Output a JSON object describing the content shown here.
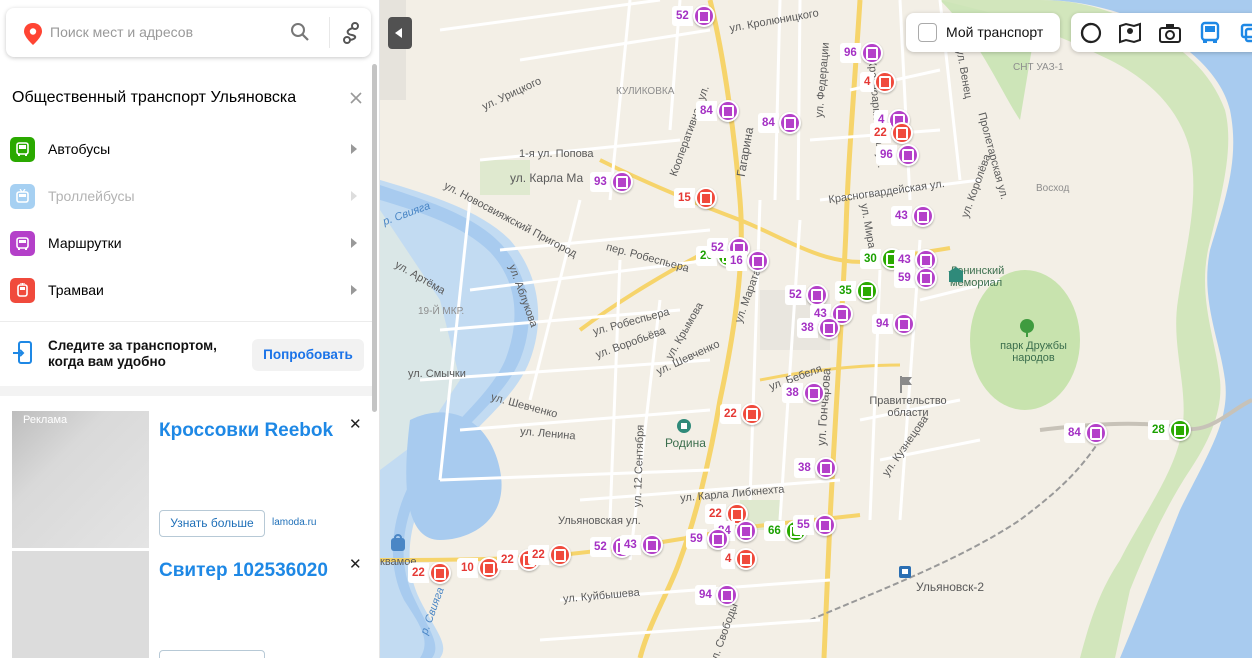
{
  "search": {
    "placeholder": "Поиск мест и адресов",
    "icon": "search-icon",
    "route_icon": "route-icon",
    "pin_icon": "location-pin-icon"
  },
  "panel": {
    "title": "Общественный транспорт Ульяновска",
    "items": [
      {
        "label": "Автобусы",
        "color": "#2aa900",
        "enabled": true
      },
      {
        "label": "Троллейбусы",
        "color": "#a6d0f2",
        "enabled": false
      },
      {
        "label": "Маршрутки",
        "color": "#b440c9",
        "enabled": true
      },
      {
        "label": "Трамваи",
        "color": "#f04a3c",
        "enabled": true
      }
    ],
    "promo": {
      "text": "Следите за транспортом, когда вам удобно",
      "button": "Попробовать"
    },
    "ads": [
      {
        "tag": "Реклама",
        "title": "Кроссовки Reebok",
        "button": "Узнать больше",
        "host": "lamoda.ru"
      },
      {
        "title": "Свитер 102536020"
      }
    ]
  },
  "map": {
    "my_transport_label": "Мой транспорт",
    "toolbar_icons": [
      "traffic-icon",
      "panorama-icon",
      "photo-icon",
      "transport-icon",
      "layers-icon"
    ],
    "labels": {
      "urickogo": "ул. Урицкого",
      "krolonitsk": "ул. Кролюницкого",
      "kulikovka": "КУЛИКОВКА",
      "popova": "1-я ул. Попова",
      "karla_marksa": "ул. Карла Ма",
      "kooperativnaya": "Кооперативная ул.",
      "gagarina": "Гагарина",
      "sviyaga_1": "р. Свияга",
      "sviyaga_2": "р. Свияга",
      "novosvijazhsky": "ул. Новосвияжский Пригород",
      "artema": "ул. Артёма",
      "abluk": "ул. Аблукова",
      "mkr19": "19-Й МКР.",
      "robespiera_1": "пер. Робеспьера",
      "robespiera_2": "ул. Робеспьера",
      "vorobieva": "ул. Воробьёва",
      "smychki": "ул. Смычки",
      "shevchenko_1": "ул. Шевченко",
      "shevchenko_2": "ул. Шевченко",
      "krymova": "ул. Крымова",
      "marata": "ул. Марата",
      "lenina": "ул. Ленина",
      "sept12": "ул. 12 Сентября",
      "rodina": "Родина",
      "bebelya": "ул. Бебеля",
      "goncharova": "ул. Гончарова",
      "karla_libknekhta": "ул. Карла Либкнехта",
      "ulyanovskaya": "Ульяновская ул.",
      "kuybysheva": "ул. Куйбышева",
      "svobody": "ул. Свободы",
      "krasnoarm": "Красноармейская ул.",
      "federacii": "ул. Федерации",
      "krasnogvard": "Красногвардейская ул.",
      "mira": "ул. Мира",
      "proletarskaya": "Пролетарская ул.",
      "koroleva": "ул. Королёва",
      "venec": "ул. Венец",
      "kuznecova": "ул. Кузнецова",
      "snt_uaz": "СНТ УАЗ-1",
      "voskhod": "Восход",
      "memorial": "Ленинский мемориал",
      "park": "парк Дружбы народов",
      "pravitelstvo": "Правительство области",
      "station": "Ульяновск-2",
      "kvamoe": "квамое"
    },
    "stops": [
      {
        "n": "52",
        "t": "mar"
      },
      {
        "n": "96",
        "t": "mar"
      },
      {
        "n": "4",
        "t": "tram"
      },
      {
        "n": "84",
        "t": "mar"
      },
      {
        "n": "84",
        "t": "mar"
      },
      {
        "n": "4",
        "t": "mar"
      },
      {
        "n": "22",
        "t": "tram"
      },
      {
        "n": "96",
        "t": "mar"
      },
      {
        "n": "93",
        "t": "mar"
      },
      {
        "n": "15",
        "t": "tram"
      },
      {
        "n": "43",
        "t": "mar"
      },
      {
        "n": "20",
        "t": "bus"
      },
      {
        "n": "52",
        "t": "mar"
      },
      {
        "n": "16",
        "t": "mar"
      },
      {
        "n": "30",
        "t": "bus"
      },
      {
        "n": "43",
        "t": "mar"
      },
      {
        "n": "59",
        "t": "mar"
      },
      {
        "n": "35",
        "t": "bus"
      },
      {
        "n": "52",
        "t": "mar"
      },
      {
        "n": "43",
        "t": "mar"
      },
      {
        "n": "94",
        "t": "mar"
      },
      {
        "n": "38",
        "t": "mar"
      },
      {
        "n": "38",
        "t": "mar"
      },
      {
        "n": "22",
        "t": "tram"
      },
      {
        "n": "38",
        "t": "mar"
      },
      {
        "n": "84",
        "t": "mar"
      },
      {
        "n": "28",
        "t": "bus"
      },
      {
        "n": "22",
        "t": "tram"
      },
      {
        "n": "84",
        "t": "mar"
      },
      {
        "n": "66",
        "t": "bus"
      },
      {
        "n": "55",
        "t": "mar"
      },
      {
        "n": "59",
        "t": "mar"
      },
      {
        "n": "4",
        "t": "tram"
      },
      {
        "n": "52",
        "t": "mar"
      },
      {
        "n": "43",
        "t": "mar"
      },
      {
        "n": "22",
        "t": "tram"
      },
      {
        "n": "10",
        "t": "tram"
      },
      {
        "n": "22",
        "t": "tram"
      },
      {
        "n": "22",
        "t": "tram"
      },
      {
        "n": "94",
        "t": "mar"
      }
    ]
  }
}
